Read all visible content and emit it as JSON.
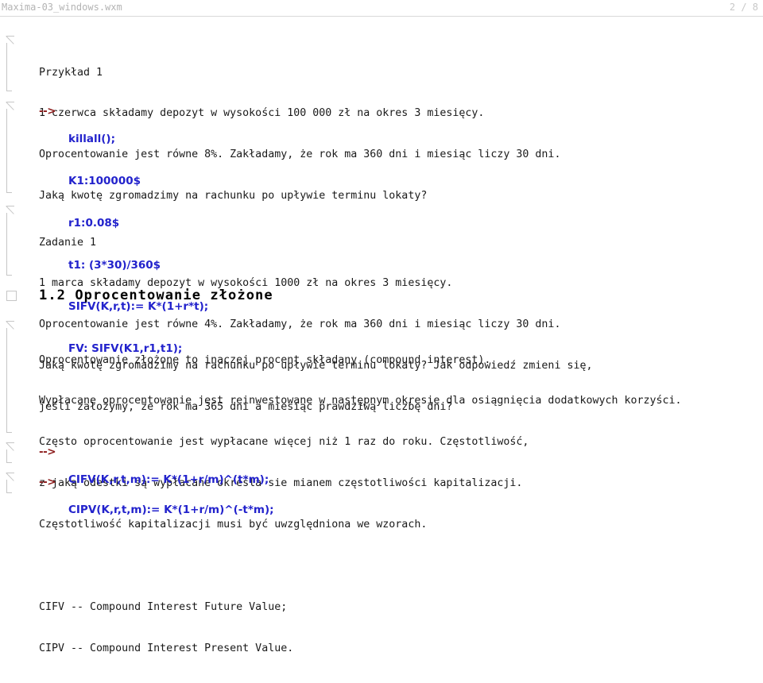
{
  "titlebar": {
    "document_name": "Maxima-03_windows.wxm",
    "page_indicator": "2 / 8"
  },
  "worksheet": {
    "cells": [
      {
        "kind": "text",
        "name": "example-1-text-cell",
        "lines": [
          "Przykład 1",
          "1 czerwca składamy depozyt w wysokości 100 000 zł na okres 3 miesięcy.",
          "Oprocentowanie jest równe 8%. Zakładamy, że rok ma 360 dni i miesiąc liczy 30 dni.",
          "Jaką kwotę zgromadzimy na rachunku po upływie terminu lokaty?"
        ]
      },
      {
        "kind": "code",
        "name": "code-cell-example-1",
        "prompt": "-->",
        "lines": [
          "killall();",
          "K1:100000$",
          "r1:0.08$",
          "t1: (3*30)/360$",
          "SIFV(K,r,t):= K*(1+r*t);",
          "FV: SIFV(K1,r1,t1);"
        ]
      },
      {
        "kind": "text",
        "name": "zadanie-1-text-cell",
        "lines": [
          "Zadanie 1",
          "1 marca składamy depozyt w wysokości 1000 zł na okres 3 miesięcy.",
          "Oprocentowanie jest równe 4%. Zakładamy, że rok ma 360 dni i miesiąc liczy 30 dni.",
          "Jaką kwotę zgromadzimy na rachunku po upływie terminu lokaty? Jak odpowiedź zmieni się,",
          "jeśli założymy, że rok ma 365 dni a miesiąc prawdziwą liczbę dni?"
        ]
      },
      {
        "kind": "heading",
        "name": "section-heading-1-2",
        "text": "1.2 Oprocentowanie złożone"
      },
      {
        "kind": "text",
        "name": "compound-interest-text-cell",
        "lines": [
          "Oprocentowanie złożone to inaczej procent składany (compound interest).",
          "Wypłacane oprocentowanie jest reinwestowane w następnym okresie dla osiągnięcia dodatkowych korzyści.",
          "Często oprocentowanie jest wypłacane więcej niż 1 raz do roku. Częstotliwość,",
          "z jaką odestki są wypłacane określa sie mianem częstotliwości kapitalizacji.",
          "Częstotliwość kapitalizacji musi być uwzględniona we wzorach.",
          "",
          "CIFV -- Compound Interest Future Value;",
          "CIPV -- Compound Interest Present Value."
        ]
      },
      {
        "kind": "code",
        "name": "code-cell-cifv",
        "prompt": "-->",
        "lines": [
          "CIFV(K,r,t,m):= K*(1+r/m)^(t*m);"
        ]
      },
      {
        "kind": "code",
        "name": "code-cell-cipv",
        "prompt": "-->",
        "lines": [
          "CIPV(K,r,t,m):= K*(1+r/m)^(-t*m);"
        ]
      }
    ]
  }
}
